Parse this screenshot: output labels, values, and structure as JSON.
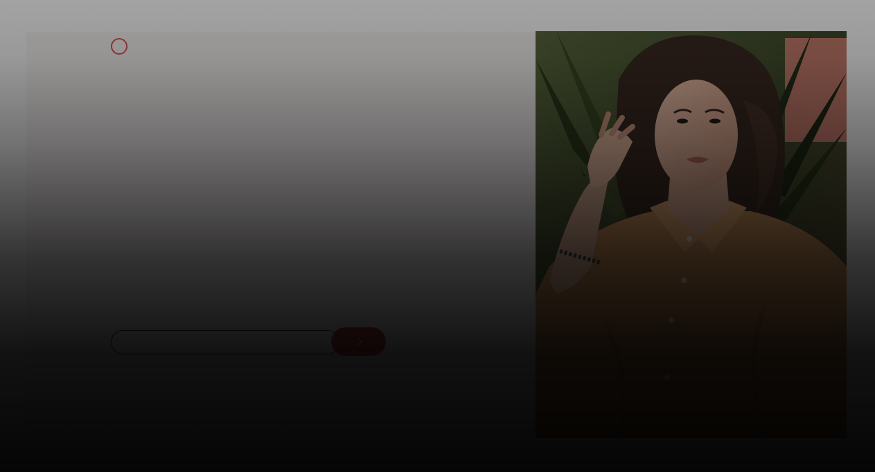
{
  "modal": {
    "loader": "loading-ring-icon",
    "heading": "",
    "description": ""
  },
  "subscribe": {
    "email_value": "",
    "email_placeholder": "",
    "submit_icon": "chevron-right-icon"
  },
  "photo": {
    "subject": "woman-portrait-image"
  },
  "colors": {
    "accent": "#c8434a",
    "loader": "#e0545b",
    "card_background": "#fbf6f6"
  }
}
